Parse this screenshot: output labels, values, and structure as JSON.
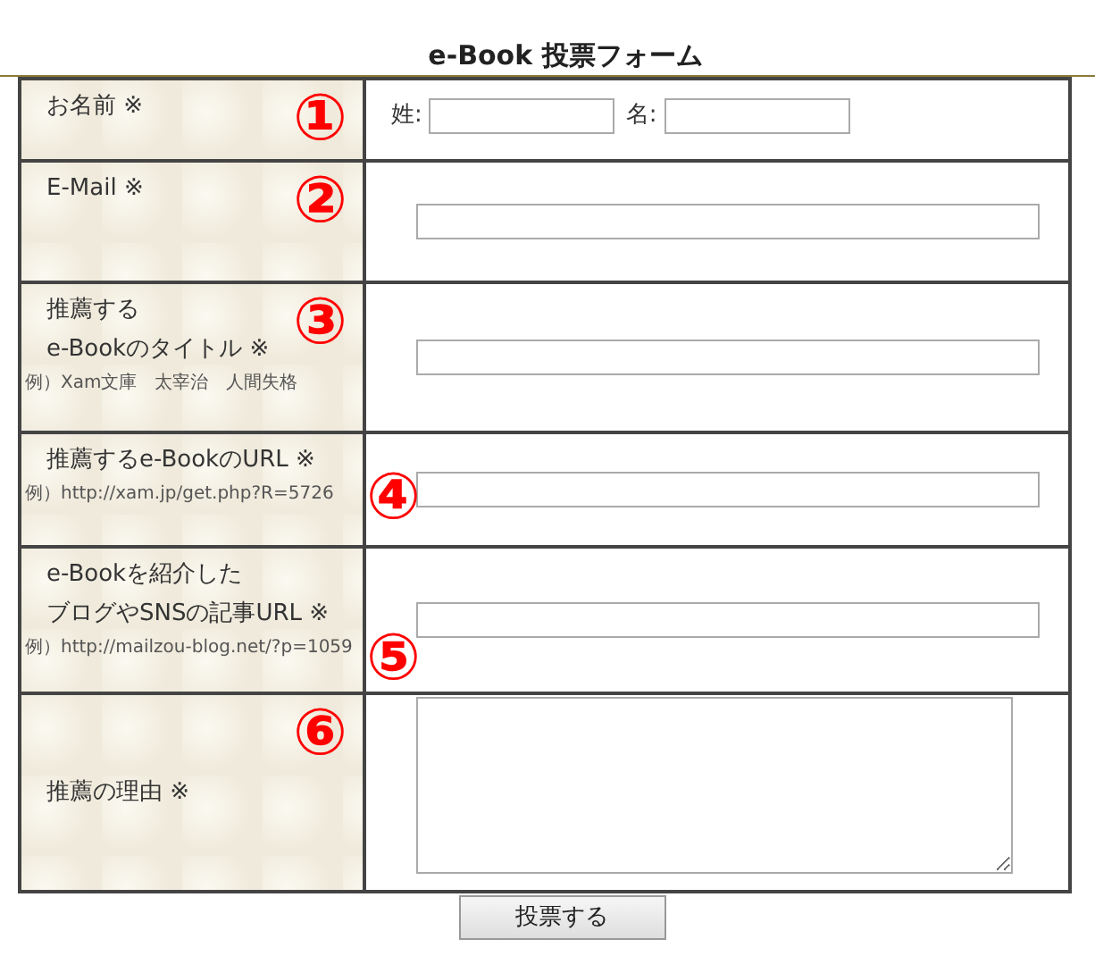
{
  "title": "e-Book 投票フォーム",
  "rows": [
    {
      "kind": "name",
      "marker": "①",
      "label_lines": [
        "お名前 ※"
      ],
      "fields": [
        {
          "label": "姓:"
        },
        {
          "label": "名:"
        }
      ]
    },
    {
      "kind": "text",
      "marker": "②",
      "label_lines": [
        "E-Mail ※"
      ]
    },
    {
      "kind": "text",
      "marker": "③",
      "label_lines": [
        "推薦する",
        "e-Bookのタイトル ※"
      ],
      "example": "例）Xam文庫　太宰治　人間失格"
    },
    {
      "kind": "text",
      "marker": "④",
      "label_lines": [
        "推薦するe-BookのURL ※"
      ],
      "example": "例）http://xam.jp/get.php?R=5726"
    },
    {
      "kind": "text",
      "marker": "⑤",
      "label_lines": [
        "e-Bookを紹介した",
        "ブログやSNSの記事URL ※"
      ],
      "example": "例）http://mailzou-blog.net/?p=1059"
    },
    {
      "kind": "textarea",
      "marker": "⑥",
      "label_lines": [
        "推薦の理由 ※"
      ]
    }
  ],
  "submit": "投票する"
}
